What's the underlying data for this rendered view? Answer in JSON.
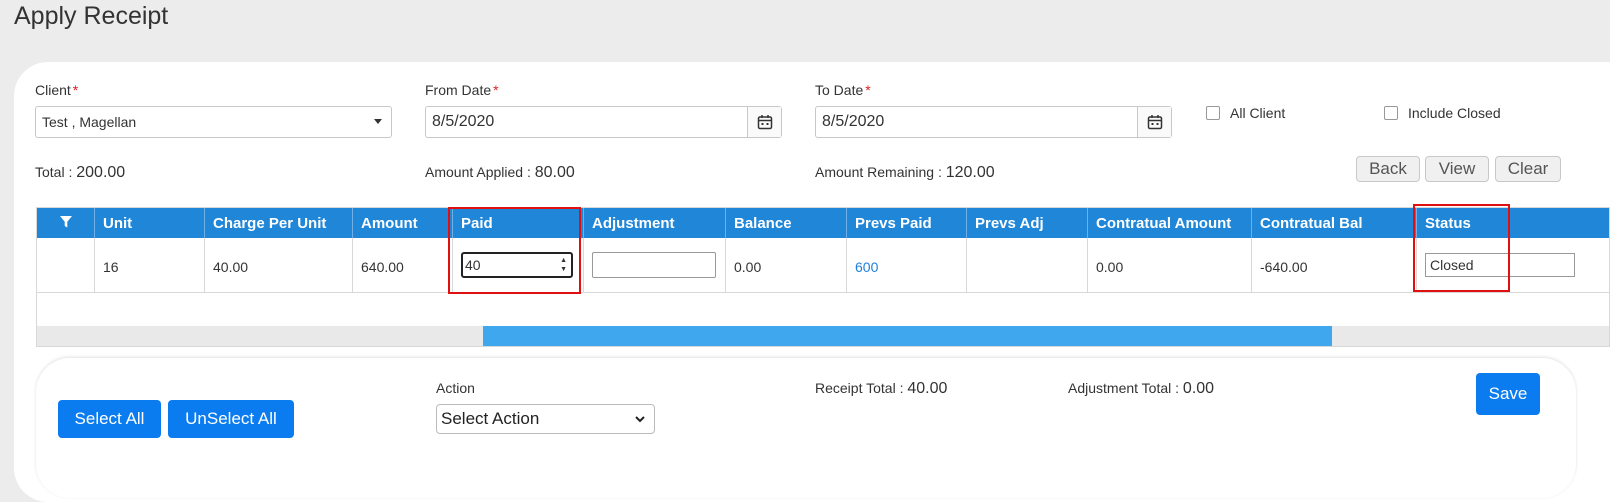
{
  "page": {
    "title": "Apply Receipt"
  },
  "filters": {
    "client_label": "Client",
    "client_value": "Test , Magellan",
    "from_date_label": "From Date",
    "from_date_value": "8/5/2020",
    "to_date_label": "To Date",
    "to_date_value": "8/5/2020",
    "required_mark": "*",
    "all_client_label": "All Client",
    "include_closed_label": "Include Closed"
  },
  "summary": {
    "total_label": "Total :",
    "total_value": "200.00",
    "applied_label": "Amount Applied :",
    "applied_value": "80.00",
    "remaining_label": "Amount Remaining :",
    "remaining_value": "120.00"
  },
  "buttons": {
    "back": "Back",
    "view": "View",
    "clear": "Clear"
  },
  "grid": {
    "columns": [
      "Unit",
      "Charge Per Unit",
      "Amount",
      "Paid",
      "Adjustment",
      "Balance",
      "Prevs Paid",
      "Prevs Adj",
      "Contratual Amount",
      "Contratual Bal",
      "Status"
    ],
    "row": {
      "unit": "16",
      "charge_per_unit": "40.00",
      "amount": "640.00",
      "paid": "40",
      "adjustment": "",
      "balance": "0.00",
      "prevs_paid": "600",
      "prevs_adj": "",
      "contratual_amount": "0.00",
      "contratual_bal": "-640.00",
      "status": "Closed"
    }
  },
  "footer": {
    "select_all": "Select All",
    "unselect_all": "UnSelect All",
    "action_label": "Action",
    "action_value": "Select Action",
    "receipt_total_label": "Receipt Total :",
    "receipt_total_value": "40.00",
    "adjustment_total_label": "Adjustment Total :",
    "adjustment_total_value": "0.00",
    "save": "Save"
  },
  "colors": {
    "header_blue": "#1f86d8",
    "button_blue": "#0a7cf0",
    "highlight_red": "#e01010"
  }
}
